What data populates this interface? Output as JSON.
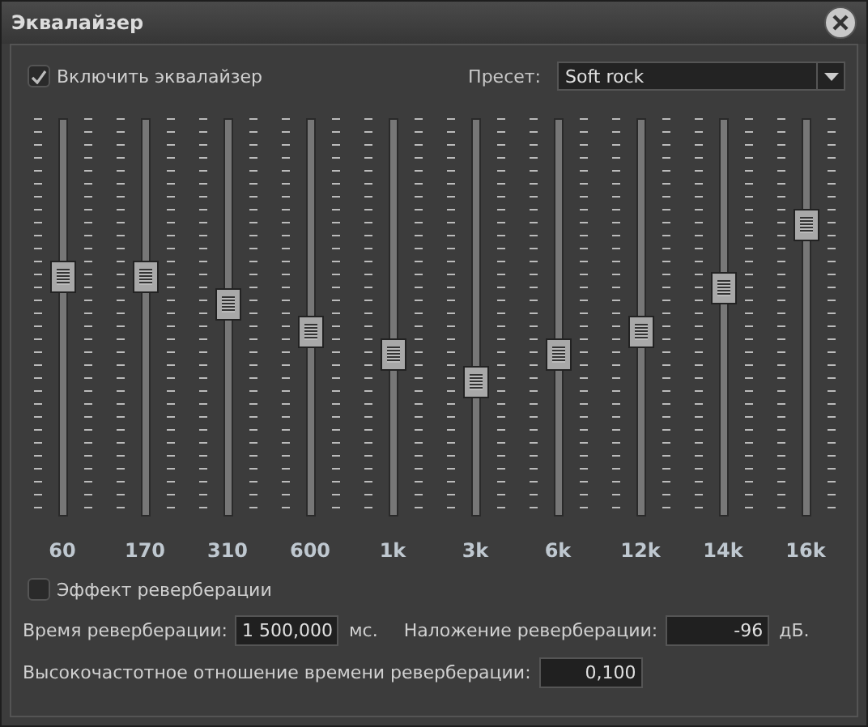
{
  "window": {
    "title": "Эквалайзер"
  },
  "enable": {
    "label": "Включить эквалайзер",
    "checked": true
  },
  "preset": {
    "label": "Пресет:",
    "value": "Soft rock"
  },
  "bands": [
    {
      "label": "60",
      "level": 0.6
    },
    {
      "label": "170",
      "level": 0.6
    },
    {
      "label": "310",
      "level": 0.53
    },
    {
      "label": "600",
      "level": 0.46
    },
    {
      "label": "1k",
      "level": 0.4
    },
    {
      "label": "3k",
      "level": 0.33
    },
    {
      "label": "6k",
      "level": 0.4
    },
    {
      "label": "12k",
      "level": 0.46
    },
    {
      "label": "14k",
      "level": 0.57
    },
    {
      "label": "16k",
      "level": 0.73
    }
  ],
  "reverb": {
    "label": "Эффект реверберации",
    "checked": false
  },
  "fields": [
    {
      "label": "Время реверберации:",
      "value": "1 500,000",
      "unit": "мс."
    },
    {
      "label": "Наложение реверберации:",
      "value": "-96",
      "unit": "дБ."
    },
    {
      "label": "Высокочастотное отношение времени реверберации:",
      "value": "0,100"
    }
  ]
}
